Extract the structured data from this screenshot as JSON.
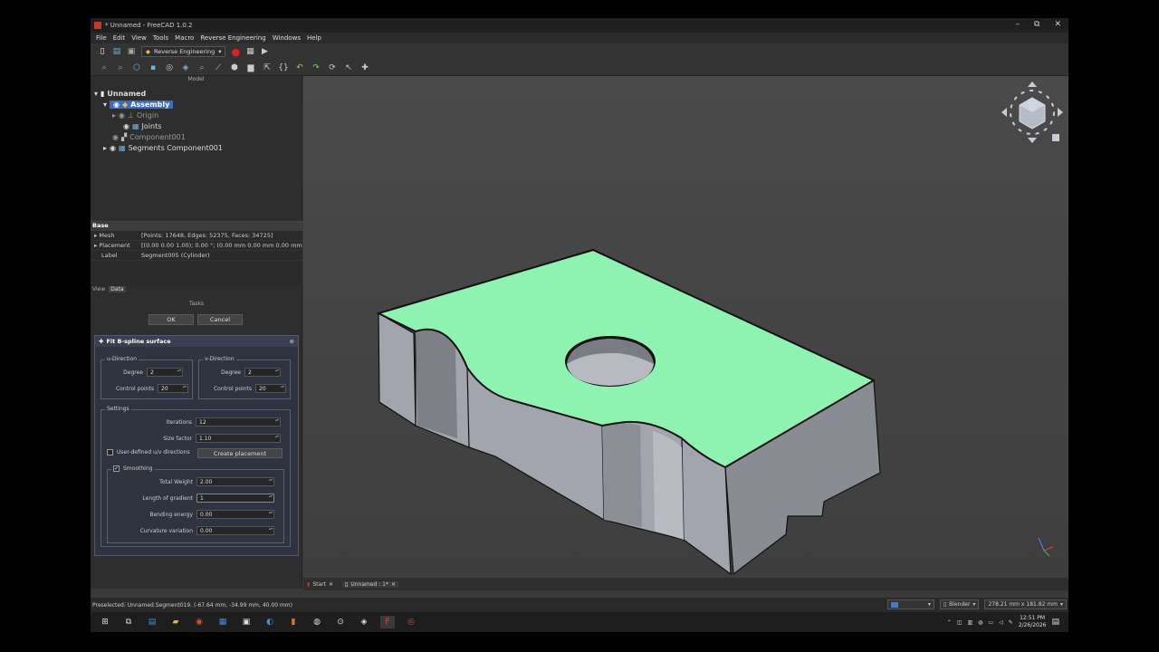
{
  "window": {
    "title": "* Unnamed - FreeCAD 1.0.2",
    "minimize": "–",
    "maximize": "⧉",
    "close": "✕"
  },
  "menu": [
    "File",
    "Edit",
    "View",
    "Tools",
    "Macro",
    "Reverse Engineering",
    "Windows",
    "Help"
  ],
  "workbench": {
    "label": "Reverse Engineering"
  },
  "model": {
    "panel_title": "Model",
    "root": "Unnamed",
    "assembly": "Assembly",
    "origin": "Origin",
    "joints": "Joints",
    "component": "Component001",
    "segments": "Segments Component001"
  },
  "properties": {
    "group": "Base",
    "rows": [
      {
        "key": "Mesh",
        "value": "[Points: 17648, Edges: 52375, Faces: 34725]"
      },
      {
        "key": "Placement",
        "value": "[(0.00 0.00 1.00); 0.00 °; (0.00 mm  0.00 mm  0.00 mm)]"
      },
      {
        "key": "Label",
        "value": "Segment005 (Cylinder)"
      }
    ],
    "tab_view": "View",
    "tab_data": "Data"
  },
  "tasks": {
    "title": "Tasks",
    "ok": "OK",
    "cancel": "Cancel",
    "box_title": "Fit B-spline surface",
    "u_direction": "u-Direction",
    "v_direction": "v-Direction",
    "degree_label": "Degree",
    "control_points_label": "Control points",
    "u_degree": "2",
    "u_control_points": "20",
    "v_degree": "2",
    "v_control_points": "20",
    "settings": "Settings",
    "iterations_label": "Iterations",
    "iterations": "12",
    "size_factor_label": "Size factor",
    "size_factor": "1.10",
    "user_defined_label": "User-defined u/v directions",
    "create_placement": "Create placement",
    "smoothing": "Smoothing",
    "total_weight_label": "Total Weight",
    "total_weight": "2.00",
    "length_gradient_label": "Length of gradient",
    "length_gradient": "1",
    "bending_label": "Bending energy",
    "bending": "0.00",
    "curvature_label": "Curvature variation",
    "curvature": "0.00"
  },
  "doc_tabs": {
    "start": "Start",
    "unnamed": "Unnamed : 1*"
  },
  "status": {
    "preselected": "Preselected: Unnamed.Segment019. (-67.64 mm, -34.99 mm, 40.00 mm)",
    "nav_style": "Blender",
    "dimensions": "278.21 mm x 181.82 mm"
  },
  "clock": {
    "time": "12:51 PM",
    "date": "2/26/2026"
  },
  "colors": {
    "green_face": "#8ef2b0",
    "grey_face": "#9ea0aa",
    "selection": "#3b6cc5"
  }
}
